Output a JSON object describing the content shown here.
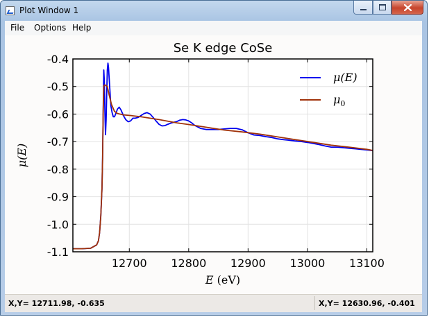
{
  "window": {
    "title": "Plot Window 1",
    "colors": {
      "frame": "#b7cde8",
      "close_button": "#c7442c"
    }
  },
  "menu": {
    "items": [
      "File",
      "Options",
      "Help"
    ]
  },
  "status": {
    "left": "X,Y= 12711.98, -0.635",
    "right": "X,Y= 12630.96, -0.401"
  },
  "chart_data": {
    "type": "line",
    "title": "Se K edge CoSe",
    "xlabel": "E (eV)",
    "ylabel": "μ(E)",
    "xlim": [
      12605,
      13110
    ],
    "ylim": [
      -1.1,
      -0.4
    ],
    "xticks": [
      12700,
      12800,
      12900,
      13000,
      13100
    ],
    "xtick_labels": [
      "12700",
      "12800",
      "12900",
      "13000",
      "13100"
    ],
    "yticks": [
      -0.4,
      -0.5,
      -0.6,
      -0.7,
      -0.8,
      -0.9,
      -1.0,
      -1.1
    ],
    "ytick_labels": [
      "-0.4",
      "-0.5",
      "-0.6",
      "-0.7",
      "-0.8",
      "-0.9",
      "-1.0",
      "-1.1"
    ],
    "grid": true,
    "legend_position": "top-right",
    "series": [
      {
        "name": "μ(E)",
        "color": "#0000ee",
        "x": [
          12605,
          12620,
          12635,
          12645,
          12648,
          12650,
          12652,
          12654,
          12655,
          12656,
          12657,
          12658,
          12659,
          12660,
          12661,
          12662,
          12663,
          12664,
          12665,
          12667,
          12669,
          12671,
          12673,
          12675,
          12677,
          12680,
          12683,
          12686,
          12690,
          12694,
          12698,
          12702,
          12706,
          12710,
          12715,
          12720,
          12725,
          12730,
          12735,
          12740,
          12745,
          12750,
          12755,
          12760,
          12765,
          12770,
          12775,
          12780,
          12785,
          12790,
          12795,
          12800,
          12805,
          12810,
          12820,
          12830,
          12840,
          12850,
          12860,
          12870,
          12880,
          12890,
          12900,
          12910,
          12920,
          12930,
          12940,
          12950,
          12960,
          12970,
          12980,
          12990,
          13000,
          13010,
          13020,
          13030,
          13040,
          13050,
          13060,
          13070,
          13080,
          13090,
          13100,
          13110
        ],
        "y": [
          -1.089,
          -1.089,
          -1.087,
          -1.075,
          -1.06,
          -1.03,
          -0.97,
          -0.87,
          -0.76,
          -0.6,
          -0.44,
          -0.48,
          -0.6,
          -0.675,
          -0.62,
          -0.52,
          -0.44,
          -0.415,
          -0.43,
          -0.5,
          -0.57,
          -0.595,
          -0.61,
          -0.61,
          -0.6,
          -0.582,
          -0.575,
          -0.585,
          -0.605,
          -0.62,
          -0.628,
          -0.625,
          -0.615,
          -0.615,
          -0.612,
          -0.605,
          -0.598,
          -0.595,
          -0.6,
          -0.612,
          -0.625,
          -0.637,
          -0.643,
          -0.642,
          -0.637,
          -0.633,
          -0.63,
          -0.627,
          -0.622,
          -0.62,
          -0.621,
          -0.625,
          -0.632,
          -0.641,
          -0.652,
          -0.656,
          -0.656,
          -0.656,
          -0.654,
          -0.652,
          -0.652,
          -0.657,
          -0.668,
          -0.676,
          -0.678,
          -0.682,
          -0.685,
          -0.69,
          -0.693,
          -0.695,
          -0.698,
          -0.7,
          -0.703,
          -0.707,
          -0.711,
          -0.716,
          -0.72,
          -0.72,
          -0.722,
          -0.724,
          -0.726,
          -0.728,
          -0.73,
          -0.733
        ]
      },
      {
        "name": "μ0",
        "color": "#a0320a",
        "x": [
          12605,
          12620,
          12635,
          12645,
          12648,
          12650,
          12652,
          12654,
          12655,
          12656,
          12657,
          12658,
          12660,
          12663,
          12666,
          12670,
          12675,
          12680,
          12690,
          12700,
          12720,
          12750,
          12780,
          12800,
          12830,
          12860,
          12890,
          12920,
          12950,
          12980,
          13010,
          13040,
          13070,
          13100,
          13110
        ],
        "y": [
          -1.089,
          -1.089,
          -1.087,
          -1.075,
          -1.06,
          -1.03,
          -0.97,
          -0.87,
          -0.76,
          -0.6,
          -0.5,
          -0.495,
          -0.495,
          -0.5,
          -0.53,
          -0.565,
          -0.59,
          -0.598,
          -0.603,
          -0.605,
          -0.61,
          -0.62,
          -0.632,
          -0.638,
          -0.648,
          -0.658,
          -0.665,
          -0.673,
          -0.683,
          -0.693,
          -0.703,
          -0.713,
          -0.72,
          -0.728,
          -0.732
        ]
      }
    ]
  }
}
